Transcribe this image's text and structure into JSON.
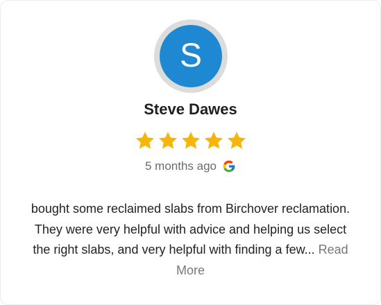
{
  "colors": {
    "avatar_bg": "#1e88d3",
    "avatar_ring": "#dcdcdc",
    "star": "#f5b50a",
    "read_more": "#777777"
  },
  "reviewer": {
    "initial": "S",
    "name": "Steve Dawes"
  },
  "rating": {
    "value": 5,
    "max": 5
  },
  "review": {
    "time_ago": "5 months ago",
    "source_icon": "google-icon",
    "text": "bought some reclaimed slabs from Birchover reclamation.  They were very helpful with advice and helping us select the right slabs, and very helpful with finding a few...",
    "read_more_label": "Read More"
  }
}
